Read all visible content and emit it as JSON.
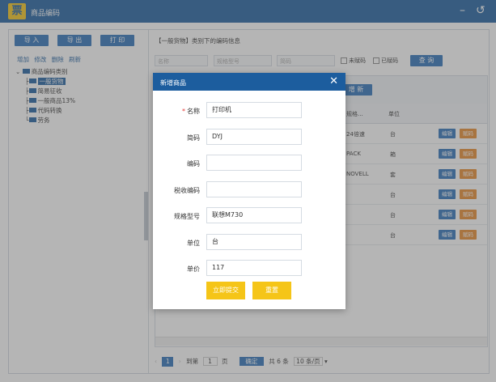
{
  "app": {
    "title": "商品编码",
    "logo_text": "票",
    "minimize_icon": "minimize-icon",
    "back_icon": "back-icon"
  },
  "left": {
    "buttons": {
      "import": "导 入",
      "export": "导 出",
      "print": "打 印"
    },
    "links": {
      "add": "增加",
      "modify": "修改",
      "delete": "删除",
      "refresh": "刷新"
    },
    "tree": {
      "root": "商品编码类别",
      "items": [
        "一般货物",
        "简易征收",
        "一般商品13%",
        "代码转换",
        "劳务"
      ],
      "selected": "一般货物"
    }
  },
  "right": {
    "title": "【一般货物】类别下的编码信息",
    "filters": {
      "name_placeholder": "名称",
      "spec_placeholder": "规格型号",
      "short_code_placeholder": "简码",
      "unassigned": "未赋码",
      "assigned": "已赋码",
      "search_button": "查 询"
    },
    "grid": {
      "new_button_fragment": "增 新",
      "columns": [
        "规格...",
        "单位",
        ""
      ],
      "rows": [
        {
          "spec": "24倍速",
          "unit": "台",
          "flag": "1"
        },
        {
          "spec": "PACK",
          "unit": "箱",
          "flag": "1"
        },
        {
          "spec": "NOVELL",
          "unit": "套",
          "flag": "1"
        },
        {
          "spec": "",
          "unit": "台",
          "flag": "1"
        },
        {
          "spec": "",
          "unit": "台",
          "flag": "1"
        },
        {
          "spec": "",
          "unit": "台",
          "flag": "1"
        }
      ],
      "edit_label": "编辑",
      "assign_label": "赋码"
    },
    "pager": {
      "current": "1",
      "goto_label": "到第",
      "goto_value": "1",
      "page_suffix": "页",
      "confirm": "确定",
      "total": "共 6 条",
      "page_size": "10 条/页"
    }
  },
  "modal": {
    "title": "新增商品",
    "fields": [
      {
        "label": "名称",
        "value": "打印机",
        "required": true
      },
      {
        "label": "简码",
        "value": "DYJ",
        "required": false
      },
      {
        "label": "编码",
        "value": "",
        "required": false
      },
      {
        "label": "税收编码",
        "value": "",
        "required": false
      },
      {
        "label": "规格型号",
        "value": "联想M730",
        "required": false
      },
      {
        "label": "单位",
        "value": "台",
        "required": false
      },
      {
        "label": "单价",
        "value": "117",
        "required": false
      }
    ],
    "required_mark": "*",
    "submit": "立即提交",
    "reset": "重置"
  },
  "colors": {
    "primary": "#1c5d9e",
    "button_blue": "#2b70b8",
    "accent_yellow": "#f5c518",
    "assign_orange": "#e8892b"
  }
}
